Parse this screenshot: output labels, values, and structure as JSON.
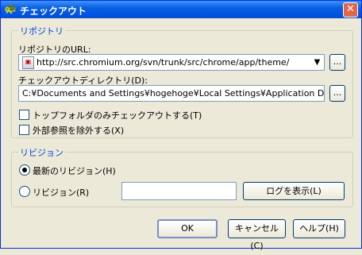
{
  "window": {
    "title": "チェックアウト",
    "close_label": "✕",
    "app_icon": "tortoise-icon"
  },
  "repository": {
    "legend": "リポジトリ",
    "url_label": "リポジトリのURL:",
    "url_value": "http://src.chromium.org/svn/trunk/src/chrome/app/theme/",
    "browse_label": "...",
    "dir_label": "チェックアウトディレクトリ(D):",
    "dir_value": "C:¥Documents and Settings¥hogehoge¥Local Settings¥Application Data¥Googl",
    "dir_browse_label": "...",
    "top_folder_label": "トップフォルダのみチェックアウトする(T)",
    "top_folder_checked": false,
    "omit_externals_label": "外部参照を除外する(X)",
    "omit_externals_checked": false
  },
  "revision": {
    "legend": "リビジョン",
    "latest_label": "最新のリビジョン(H)",
    "latest_selected": true,
    "revision_label": "リビジョン(R)",
    "revision_value": "",
    "show_log_label": "ログを表示(L)"
  },
  "buttons": {
    "ok": "OK",
    "cancel": "キャンセル(C)",
    "help": "ヘルプ(H)"
  }
}
